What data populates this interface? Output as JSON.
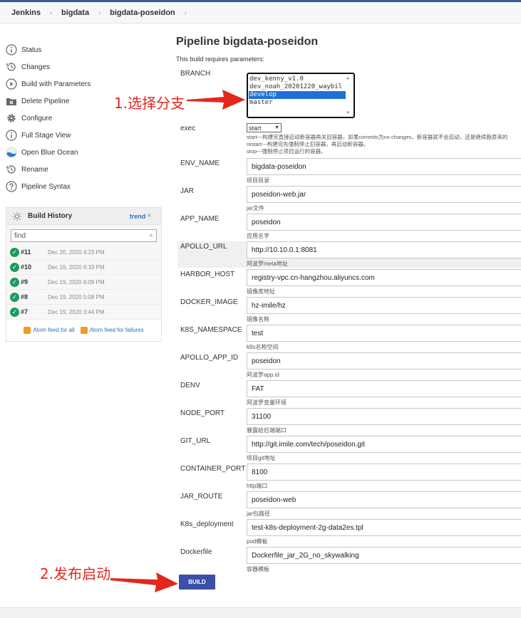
{
  "breadcrumb": [
    "Jenkins",
    "bigdata",
    "bigdata-poseidon"
  ],
  "sidebar": {
    "items": [
      {
        "label": "Status",
        "icon": "info-icon"
      },
      {
        "label": "Changes",
        "icon": "history-icon"
      },
      {
        "label": "Build with Parameters",
        "icon": "play-icon"
      },
      {
        "label": "Delete Pipeline",
        "icon": "delete-folder-icon"
      },
      {
        "label": "Configure",
        "icon": "gear-icon"
      },
      {
        "label": "Full Stage View",
        "icon": "info-icon"
      },
      {
        "label": "Open Blue Ocean",
        "icon": "blue-ocean-icon"
      },
      {
        "label": "Rename",
        "icon": "history-icon"
      },
      {
        "label": "Pipeline Syntax",
        "icon": "question-icon"
      }
    ]
  },
  "build_history": {
    "title": "Build History",
    "trend": "trend",
    "search_placeholder": "find",
    "builds": [
      {
        "num": "#11",
        "date": "Dec 20, 2020 4:23 PM"
      },
      {
        "num": "#10",
        "date": "Dec 19, 2020 6:33 PM"
      },
      {
        "num": "#9",
        "date": "Dec 19, 2020 6:09 PM"
      },
      {
        "num": "#8",
        "date": "Dec 19, 2020 5:08 PM"
      },
      {
        "num": "#7",
        "date": "Dec 19, 2020 3:44 PM"
      }
    ],
    "feed_all": "Atom feed for all",
    "feed_failures": "Atom feed for failures"
  },
  "main": {
    "title": "Pipeline bigdata-poseidon",
    "subtitle": "This build requires parameters:"
  },
  "branch": {
    "label": "BRANCH",
    "options": [
      "dev_kenny_v1.0",
      "dev_noah_20201220_waybil",
      "develop",
      "master"
    ],
    "selected": "develop"
  },
  "exec": {
    "label": "exec",
    "value": "start",
    "desc_lines": [
      "start---构建完直接启动新容器再关旧容器，如果commits为no changes，新容器就不会启动，还是继续跑原来的",
      "restart---构建完先强制停止旧容器，再启动新容器。",
      "stop---强制停止项目运行的容器。"
    ]
  },
  "params": [
    {
      "name": "ENV_NAME",
      "value": "bigdata-poseidon",
      "desc": "项目目录"
    },
    {
      "name": "JAR",
      "value": "poseidon-web.jar",
      "desc": "jar文件"
    },
    {
      "name": "APP_NAME",
      "value": "poseidon",
      "desc": "应用名字"
    },
    {
      "name": "APOLLO_URL",
      "value": "http://10.10.0.1:8081",
      "desc": "阿波罗meta地址"
    },
    {
      "name": "HARBOR_HOST",
      "value": "registry-vpc.cn-hangzhou.aliyuncs.com",
      "desc": "镜像库地址"
    },
    {
      "name": "DOCKER_IMAGE",
      "value": "hz-imile/hz",
      "desc": "镜像名称"
    },
    {
      "name": "K8S_NAMESPACE",
      "value": "test",
      "desc": "k8s名称空间"
    },
    {
      "name": "APOLLO_APP_ID",
      "value": "poseidon",
      "desc": "阿波罗app.id"
    },
    {
      "name": "DENV",
      "value": "FAT",
      "desc": "阿波罗变量环境"
    },
    {
      "name": "NODE_PORT",
      "value": "31100",
      "desc": "暴露给后端端口"
    },
    {
      "name": "GIT_URL",
      "value": "http://git.imile.com/tech/poseidon.git",
      "desc": "项目git地址"
    },
    {
      "name": "CONTAINER_PORT",
      "value": "8100",
      "desc": "http端口"
    },
    {
      "name": "JAR_ROUTE",
      "value": "poseidon-web",
      "desc": "jar包路径"
    },
    {
      "name": "K8s_deployment",
      "value": "test-k8s-deployment-2g-data2es.tpl",
      "desc": "pod模板"
    },
    {
      "name": "Dockerfile",
      "value": "Dockerfile_jar_2G_no_skywalking",
      "desc": "容器模板"
    }
  ],
  "build_button": "BUILD",
  "annotations": {
    "step1": "1.选择分支",
    "step2": "2.发布启动"
  }
}
